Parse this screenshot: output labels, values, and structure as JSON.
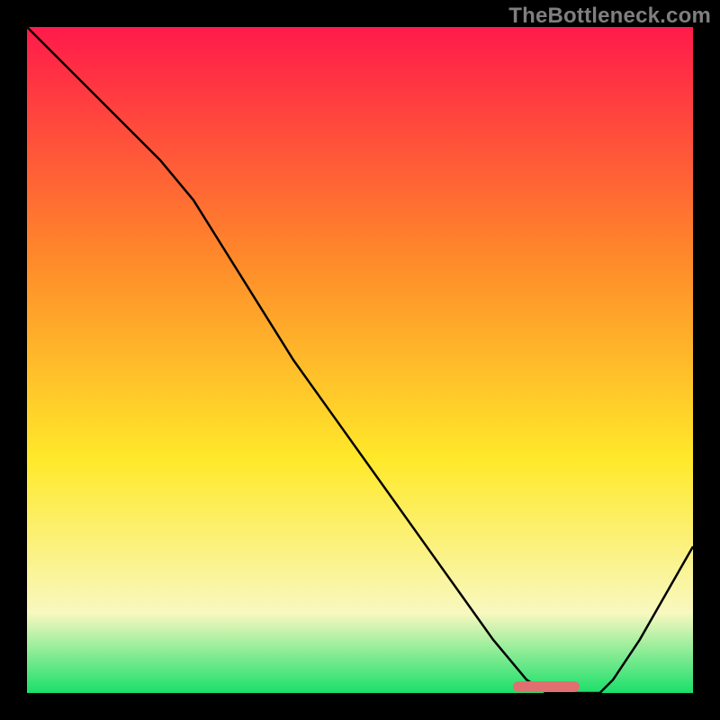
{
  "watermark": "TheBottleneck.com",
  "colors": {
    "red": "#ff1a4a",
    "orange": "#ff8a2a",
    "yellow": "#ffe92a",
    "pale": "#f8f8c0",
    "green": "#1adf6a",
    "line": "#000000",
    "marker": "#e07070",
    "frame": "#000000"
  },
  "marker": {
    "x_pct": 78,
    "width_pct": 10,
    "y_pct": 99
  },
  "chart_data": {
    "type": "line",
    "title": "",
    "xlabel": "",
    "ylabel": "",
    "xlim": [
      0,
      100
    ],
    "ylim": [
      0,
      100
    ],
    "grid": false,
    "legend": false,
    "series": [
      {
        "name": "bottleneck-curve",
        "x": [
          0,
          5,
          10,
          15,
          20,
          25,
          30,
          35,
          40,
          45,
          50,
          55,
          60,
          65,
          70,
          75,
          78,
          82,
          86,
          88,
          92,
          96,
          100
        ],
        "values": [
          100,
          95,
          90,
          85,
          80,
          74,
          66,
          58,
          50,
          43,
          36,
          29,
          22,
          15,
          8,
          2,
          0,
          0,
          0,
          2,
          8,
          15,
          22
        ]
      }
    ],
    "annotations": [
      {
        "type": "highlight-band",
        "x_start": 78,
        "x_end": 88,
        "y": 0
      }
    ],
    "gradient_stops": [
      {
        "pct": 0,
        "color": "#ff1a4a"
      },
      {
        "pct": 35,
        "color": "#ff8a2a"
      },
      {
        "pct": 65,
        "color": "#ffe92a"
      },
      {
        "pct": 88,
        "color": "#f8f8c0"
      },
      {
        "pct": 100,
        "color": "#1adf6a"
      }
    ]
  }
}
